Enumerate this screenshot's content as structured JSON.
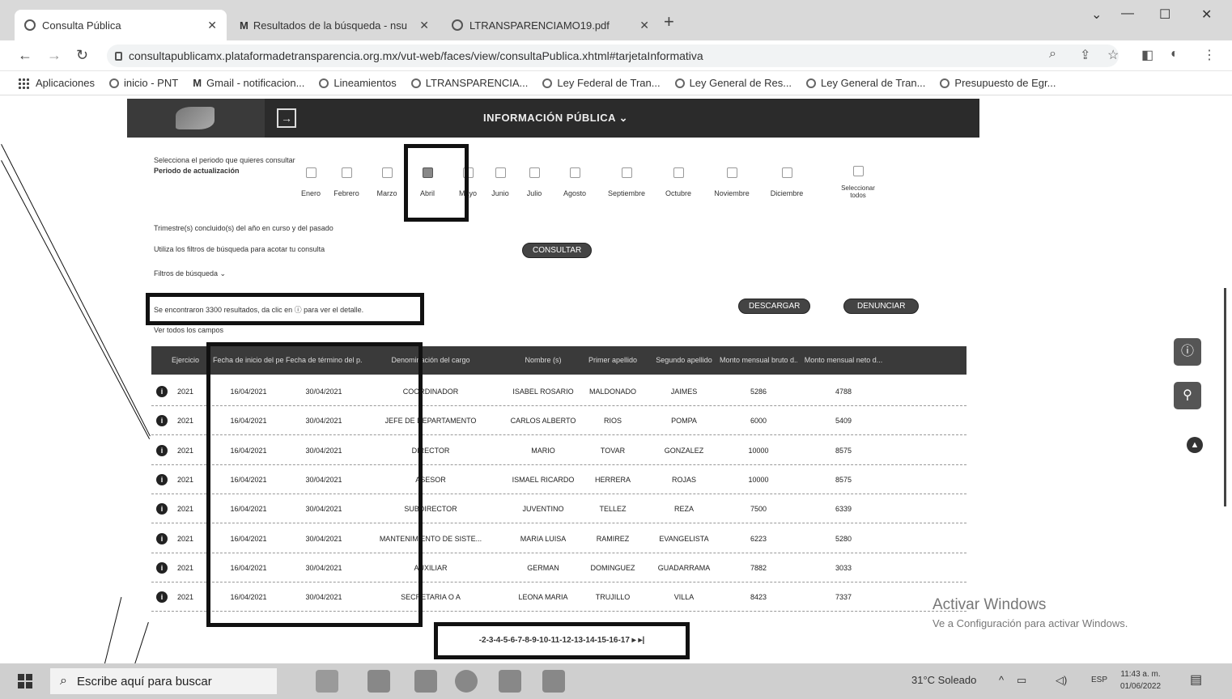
{
  "browser": {
    "tabs": [
      {
        "title": "Consulta Pública",
        "icon": "globe-icon"
      },
      {
        "title": "Resultados de la búsqueda - nsu",
        "icon": "gmail-icon"
      },
      {
        "title": "LTRANSPARENCIAMO19.pdf",
        "icon": "globe-icon"
      }
    ],
    "url": "consultapublicamx.plataformadetransparencia.org.mx/vut-web/faces/view/consultaPublica.xhtml#tarjetaInformativa",
    "bookmarks": [
      "Aplicaciones",
      "inicio - PNT",
      "Gmail - notificacion...",
      "Lineamientos",
      "LTRANSPARENCIA...",
      "Ley Federal de Tran...",
      "Ley General de Res...",
      "Ley General de Tran...",
      "Presupuesto de Egr..."
    ]
  },
  "portal": {
    "menu": "INFORMACIÓN PÚBLICA ⌄"
  },
  "filters": {
    "period_prompt": "Selecciona el periodo que quieres consultar",
    "period_label": "Periodo de actualización",
    "months": [
      {
        "label": "Enero",
        "checked": false
      },
      {
        "label": "Febrero",
        "checked": false
      },
      {
        "label": "Marzo",
        "checked": false
      },
      {
        "label": "Abril",
        "checked": true
      },
      {
        "label": "Mayo",
        "checked": false
      },
      {
        "label": "Junio",
        "checked": false
      },
      {
        "label": "Julio",
        "checked": false
      },
      {
        "label": "Agosto",
        "checked": false
      },
      {
        "label": "Septiembre",
        "checked": false
      },
      {
        "label": "Octubre",
        "checked": false
      },
      {
        "label": "Noviembre",
        "checked": false
      },
      {
        "label": "Diciembre",
        "checked": false
      }
    ],
    "select_all": "Seleccionar todos",
    "quarter_text": "Trimestre(s) concluido(s) del año en curso y del pasado",
    "hint": "Utiliza los filtros de búsqueda para acotar tu consulta",
    "consult_button": "CONSULTAR",
    "filters_toggle": "Filtros de búsqueda ⌄"
  },
  "results": {
    "summary": "Se encontraron 3300 resultados, da clic en ⓘ para ver el detalle.",
    "see_all": "Ver todos los campos",
    "download_button": "DESCARGAR",
    "report_button": "DENUNCIAR",
    "columns": [
      "Ejercicio",
      "Fecha de inicio del peri...",
      "Fecha de término del p...",
      "Denominación del cargo",
      "Nombre (s)",
      "Primer apellido",
      "Segundo apellido",
      "Monto mensual bruto d...",
      "Monto mensual neto d..."
    ],
    "rows": [
      [
        "2021",
        "16/04/2021",
        "30/04/2021",
        "COORDINADOR",
        "ISABEL ROSARIO",
        "MALDONADO",
        "JAIMES",
        "5286",
        "4788"
      ],
      [
        "2021",
        "16/04/2021",
        "30/04/2021",
        "JEFE DE DEPARTAMENTO",
        "CARLOS ALBERTO",
        "RIOS",
        "POMPA",
        "6000",
        "5409"
      ],
      [
        "2021",
        "16/04/2021",
        "30/04/2021",
        "DIRECTOR",
        "MARIO",
        "TOVAR",
        "GONZALEZ",
        "10000",
        "8575"
      ],
      [
        "2021",
        "16/04/2021",
        "30/04/2021",
        "ASESOR",
        "ISMAEL RICARDO",
        "HERRERA",
        "ROJAS",
        "10000",
        "8575"
      ],
      [
        "2021",
        "16/04/2021",
        "30/04/2021",
        "SUBDIRECTOR",
        "JUVENTINO",
        "TELLEZ",
        "REZA",
        "7500",
        "6339"
      ],
      [
        "2021",
        "16/04/2021",
        "30/04/2021",
        "MANTENIMIENTO DE SISTE...",
        "MARIA LUISA",
        "RAMIREZ",
        "EVANGELISTA",
        "6223",
        "5280"
      ],
      [
        "2021",
        "16/04/2021",
        "30/04/2021",
        "AUXILIAR",
        "GERMAN",
        "DOMINGUEZ",
        "GUADARRAMA",
        "7882",
        "3033"
      ],
      [
        "2021",
        "16/04/2021",
        "30/04/2021",
        "SECRETARIA O A",
        "LEONA MARIA",
        "TRUJILLO",
        "VILLA",
        "8423",
        "7337"
      ]
    ],
    "pagination": "-2-3-4-5-6-7-8-9-10-11-12-13-14-15-16-17 ▸ ▸|"
  },
  "watermark": {
    "line1": "Activar Windows",
    "line2": "Ve a Configuración para activar Windows."
  },
  "taskbar": {
    "search_placeholder": "Escribe aquí para buscar",
    "weather": "31°C Soleado",
    "lang": "ESP",
    "time": "11:43 a. m.",
    "date": "01/06/2022"
  }
}
